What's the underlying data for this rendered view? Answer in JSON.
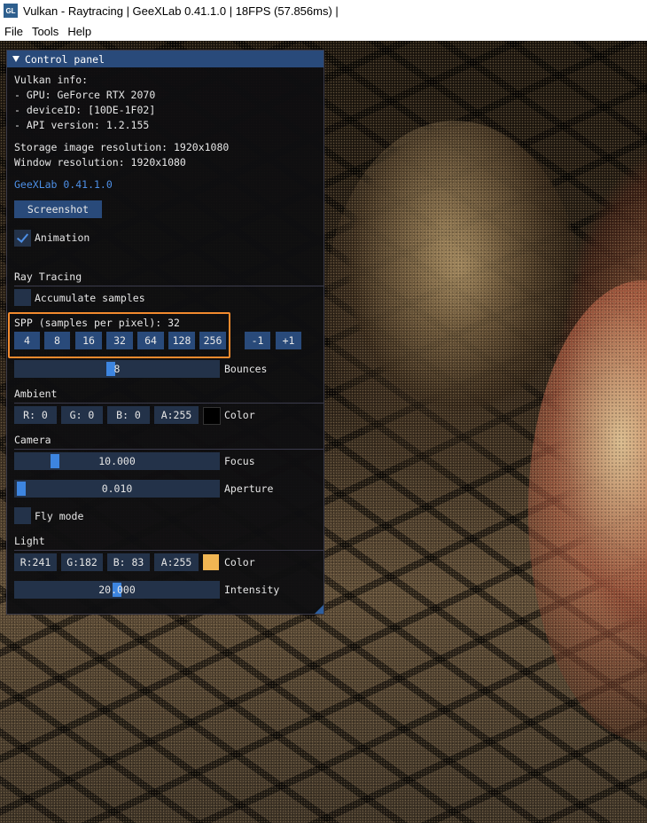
{
  "window": {
    "title": "Vulkan - Raytracing | GeeXLab 0.41.1.0 | 18FPS (57.856ms) |",
    "app_icon": "GL"
  },
  "menu": [
    "File",
    "Tools",
    "Help"
  ],
  "panel": {
    "title": "Control panel",
    "vulkan_info": "Vulkan info:",
    "gpu": "- GPU: GeForce RTX 2070",
    "device_id": "- deviceID: [10DE-1F02]",
    "api_version": "- API version: 1.2.155",
    "storage_res": "Storage image resolution: 1920x1080",
    "window_res": "Window resolution: 1920x1080",
    "version_link": "GeeXLab 0.41.1.0",
    "screenshot_label": "Screenshot",
    "animation_label": "Animation",
    "animation_checked": true,
    "ray_tracing": {
      "header": "Ray Tracing",
      "accumulate_label": "Accumulate samples",
      "accumulate_checked": false,
      "spp_label": "SPP (samples per pixel): 32",
      "spp_values": [
        "4",
        "8",
        "16",
        "32",
        "64",
        "128",
        "256"
      ],
      "decrement": "-1",
      "increment": "+1",
      "bounces_value": "8",
      "bounces_label": "Bounces"
    },
    "ambient": {
      "header": "Ambient",
      "r": "R:  0",
      "g": "G:  0",
      "b": "B:  0",
      "a": "A:255",
      "color_label": "Color",
      "swatch": "#000000"
    },
    "camera": {
      "header": "Camera",
      "focus_value": "10.000",
      "focus_label": "Focus",
      "aperture_value": "0.010",
      "aperture_label": "Aperture",
      "fly_label": "Fly mode",
      "fly_checked": false
    },
    "light": {
      "header": "Light",
      "r": "R:241",
      "g": "G:182",
      "b": "B: 83",
      "a": "A:255",
      "color_label": "Color",
      "swatch": "#f1b653",
      "intensity_value": "20.000",
      "intensity_label": "Intensity"
    }
  },
  "colors": {
    "accent": "#294a7a",
    "highlight": "#f28a2e",
    "link": "#4d8fe6"
  }
}
